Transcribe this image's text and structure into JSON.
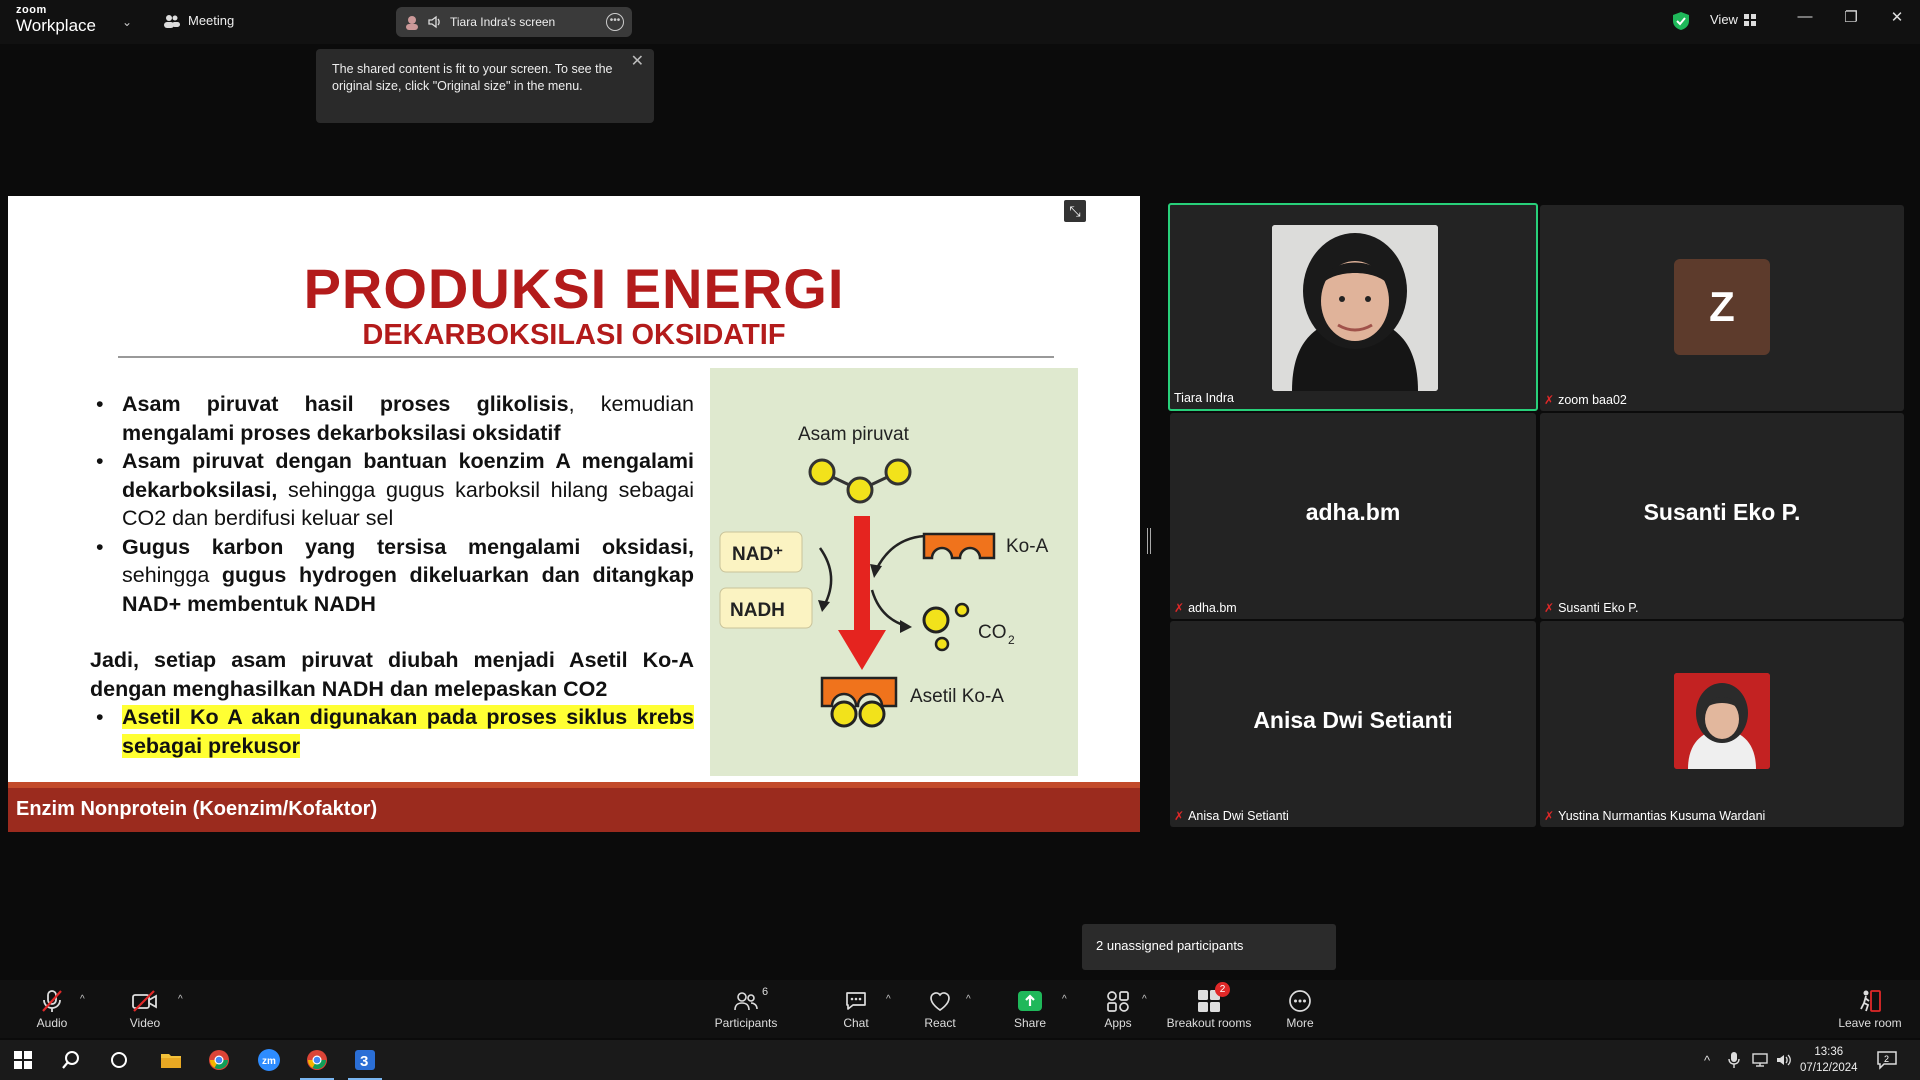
{
  "titlebar": {
    "brand_top": "zoom",
    "brand_bottom": "Workplace",
    "meeting_label": "Meeting",
    "share_label": "Tiara Indra's screen",
    "view_label": "View"
  },
  "tooltip": {
    "text": "The shared content is fit to your screen. To see the original size, click \"Original size\" in the menu."
  },
  "slide": {
    "title": "PRODUKSI ENERGI",
    "subtitle": "DEKARBOKSILASI OKSIDATIF",
    "bullet1_bold": "Asam piruvat hasil proses glikolisis",
    "bullet1_rest": ", kemudian ",
    "bullet1_bold2": "mengalami proses dekarboksilasi oksidatif",
    "bullet2_bold": "Asam piruvat dengan bantuan koenzim A mengalami dekarboksilasi,",
    "bullet2_rest": " sehingga gugus karboksil hilang sebagai CO2 dan berdifusi keluar sel",
    "bullet3_bold": "Gugus karbon yang tersisa mengalami oksidasi,",
    "bullet3_rest": " sehingga ",
    "bullet3_bold2": "gugus hydrogen dikeluarkan dan ditangkap NAD+ membentuk NADH",
    "conclusion": "Jadi, setiap asam piruvat diubah menjadi Asetil Ko-A dengan menghasilkan NADH dan melepaskan CO2",
    "bullet4": "Asetil Ko A akan digunakan pada proses siklus krebs sebagai prekusor",
    "diagram": {
      "pyruvate": "Asam piruvat",
      "nad": "NAD⁺",
      "nadh": "NADH",
      "koa": "Ko-A",
      "co2": "CO",
      "co2_sub": "2",
      "acetyl": "Asetil Ko-A"
    },
    "footer": "Enzim Nonprotein (Koenzim/Kofaktor)"
  },
  "participants": [
    {
      "name": "Tiara Indra",
      "display": "",
      "muted": false
    },
    {
      "name": "zoom baa02",
      "display": "Z",
      "muted": true
    },
    {
      "name": "adha.bm",
      "display": "adha.bm",
      "muted": true
    },
    {
      "name": "Susanti Eko P.",
      "display": "Susanti Eko P.",
      "muted": true
    },
    {
      "name": "Anisa Dwi Setianti",
      "display": "Anisa Dwi Setianti",
      "muted": true
    },
    {
      "name": "Yustina Nurmantias Kusuma Wardani",
      "display": "",
      "muted": true
    }
  ],
  "unassigned": "2 unassigned participants",
  "toolbar": {
    "audio": "Audio",
    "video": "Video",
    "participants": "Participants",
    "participants_count": "6",
    "chat": "Chat",
    "react": "React",
    "share": "Share",
    "apps": "Apps",
    "breakout": "Breakout rooms",
    "breakout_badge": "2",
    "more": "More",
    "leave": "Leave room"
  },
  "taskbar": {
    "time": "13:36",
    "date": "07/12/2024",
    "notif_count": "2"
  },
  "colors": {
    "accent_green": "#28d07a",
    "slide_red": "#b31b1b",
    "footer_red": "#9b2b1e",
    "highlight": "#ffff33"
  }
}
